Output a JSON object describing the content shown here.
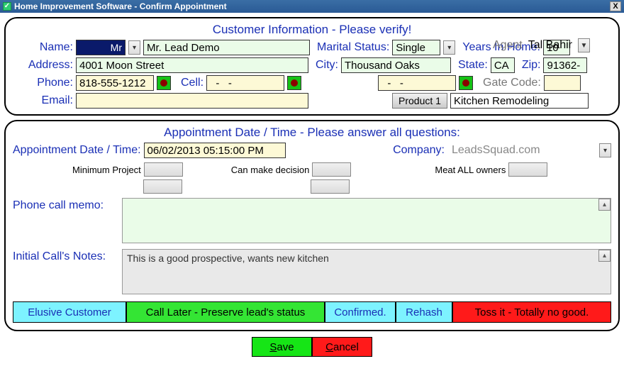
{
  "window": {
    "title": "Home Improvement Software - Confirm Appointment",
    "close": "X"
  },
  "customer": {
    "title": "Customer Information - Please verify!",
    "agent_label": "Agent",
    "agent_value": "Tal Bahir",
    "name_label": "Name:",
    "salutation": "Mr",
    "name_value": "Mr. Lead Demo",
    "marital_label": "Marital Status:",
    "marital_value": "Single",
    "years_label": "Years In Home:",
    "years_value": "10",
    "address_label": "Address:",
    "address_value": "4001 Moon Street",
    "city_label": "City:",
    "city_value": "Thousand Oaks",
    "state_label": "State:",
    "state_value": "CA",
    "zip_label": "Zip:",
    "zip_value": "91362-",
    "phone_label": "Phone:",
    "phone_value": "818-555-1212",
    "cell_label": "Cell:",
    "cell_value": "  -   -",
    "phone3_value": "  -   -",
    "gate_label": "Gate Code:",
    "gate_value": "",
    "email_label": "Email:",
    "email_value": "",
    "product_btn": "Product 1",
    "product_value": "Kitchen Remodeling"
  },
  "appt": {
    "title": "Appointment Date / Time - Please answer all questions:",
    "dt_label": "Appointment Date / Time:",
    "dt_value": "06/02/2013 05:15:00 PM",
    "company_label": "Company:",
    "company_value": "LeadsSquad.com",
    "min_label": "Minimum Project",
    "dec_label": "Can make decision",
    "own_label": "Meat ALL owners",
    "memo_label": "Phone call memo:",
    "memo_value": "",
    "notes_label": "Initial Call's Notes:",
    "notes_value": "This is a good prospective, wants new kitchen"
  },
  "actions": {
    "elusive": "Elusive Customer",
    "later": "Call Later - Preserve lead's status",
    "confirmed": "Confirmed.",
    "rehash": "Rehash",
    "toss": "Toss it - Totally no good."
  },
  "bottom": {
    "save": "Save",
    "cancel": "Cancel"
  }
}
